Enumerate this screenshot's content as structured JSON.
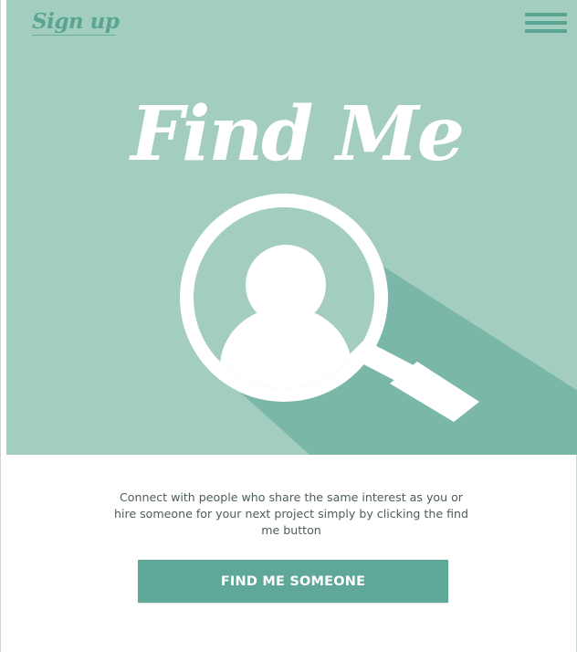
{
  "header": {
    "signup_label": "Sign up",
    "menu_icon": "hamburger-menu-icon"
  },
  "hero": {
    "title": "Find Me",
    "icon": "magnifier-person-icon"
  },
  "content": {
    "description": "Connect with people who share the same interest as you or hire someone for your next project simply by clicking the find me button",
    "button_label": "FIND ME SOMEONE"
  },
  "colors": {
    "hero_background": "#a3cdbf",
    "hero_shadow": "#7bb7a8",
    "accent": "#5fa797",
    "text": "#4d5d5b"
  }
}
